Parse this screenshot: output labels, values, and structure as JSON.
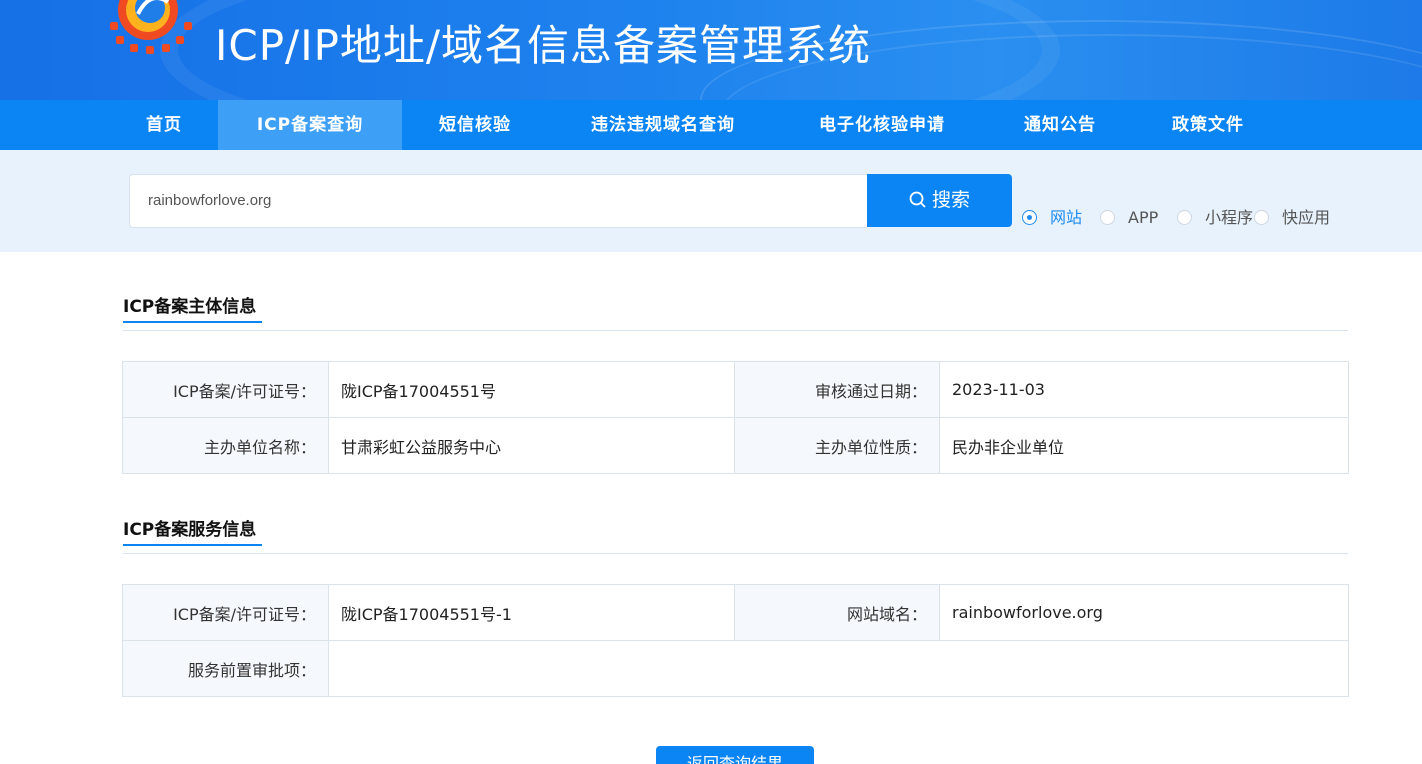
{
  "header": {
    "title": "ICP/IP地址/域名信息备案管理系统",
    "logo_icon": "gear-logo-icon"
  },
  "nav": {
    "items": [
      {
        "label": "首页",
        "active": false
      },
      {
        "label": "ICP备案查询",
        "active": true
      },
      {
        "label": "短信核验",
        "active": false
      },
      {
        "label": "违法违规域名查询",
        "active": false
      },
      {
        "label": "电子化核验申请",
        "active": false
      },
      {
        "label": "通知公告",
        "active": false
      },
      {
        "label": "政策文件",
        "active": false
      }
    ]
  },
  "search": {
    "value": "rainbowforlove.org",
    "button_label": "搜索",
    "button_icon": "search-icon",
    "types": [
      {
        "label": "网站",
        "checked": true
      },
      {
        "label": "APP",
        "checked": false
      },
      {
        "label": "小程序",
        "checked": false
      },
      {
        "label": "快应用",
        "checked": false
      }
    ]
  },
  "subject_section": {
    "title": "ICP备案主体信息",
    "rows": [
      {
        "label1": "ICP备案/许可证号：",
        "value1": "陇ICP备17004551号",
        "label2": "审核通过日期：",
        "value2": "2023-11-03"
      },
      {
        "label1": "主办单位名称：",
        "value1": "甘肃彩虹公益服务中心",
        "label2": "主办单位性质：",
        "value2": "民办非企业单位"
      }
    ]
  },
  "service_section": {
    "title": "ICP备案服务信息",
    "row1": {
      "label1": "ICP备案/许可证号：",
      "value1": "陇ICP备17004551号-1",
      "label2": "网站域名：",
      "value2": "rainbowforlove.org"
    },
    "row2": {
      "label": "服务前置审批项：",
      "value": ""
    }
  },
  "actions": {
    "back_label": "返回查询结果"
  },
  "colors": {
    "primary": "#0b85f4",
    "nav_active": "#3d9ff6",
    "search_bg": "#e8f2fd",
    "label_bg": "#f5f9fd"
  }
}
